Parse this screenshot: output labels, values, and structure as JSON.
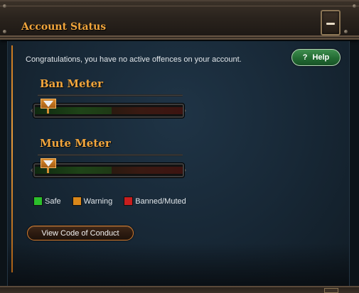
{
  "header": {
    "title": "Account Status",
    "collapse_icon": "minus-icon"
  },
  "panel": {
    "message": "Congratulations, you have no active offences on your account.",
    "help_button": {
      "label": "Help",
      "icon": "?"
    }
  },
  "meters": [
    {
      "label": "Ban Meter",
      "level": 0
    },
    {
      "label": "Mute Meter",
      "level": 0
    }
  ],
  "legend": [
    {
      "label": "Safe",
      "color": "#2bbf2b"
    },
    {
      "label": "Warning",
      "color": "#d9871a"
    },
    {
      "label": "Banned/Muted",
      "color": "#c81e1e"
    }
  ],
  "conduct_button": {
    "label": "View Code of Conduct"
  },
  "colors": {
    "accent": "#f1a53c",
    "help_green": "#236b33",
    "button_border": "#d27b2f"
  }
}
